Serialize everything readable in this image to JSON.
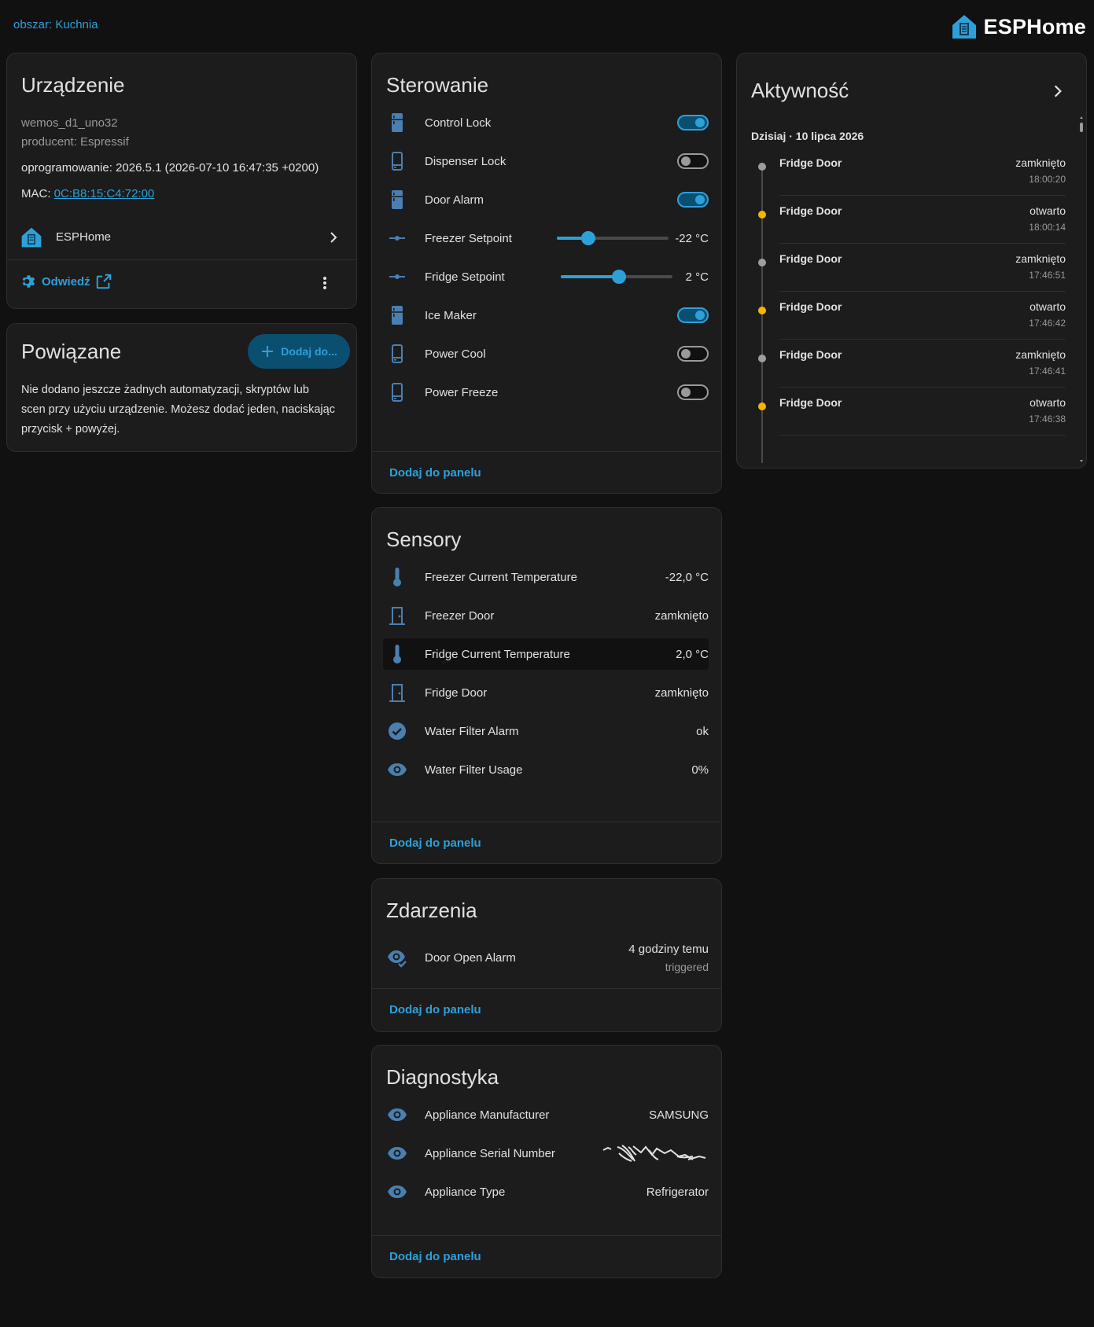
{
  "header": {
    "area_link": "obszar: Kuchnia",
    "brand": "ESPHome",
    "brand_color": "#2ea0d8"
  },
  "device": {
    "title": "Urządzenie",
    "model": "wemos_d1_uno32",
    "manufacturer": "producent: Espressif",
    "firmware": "oprogramowanie: 2026.5.1 (2026-07-10 16:47:35 +0200)",
    "mac_label": "MAC: ",
    "mac": "0C:B8:15:C4:72:00",
    "integration": "ESPHome",
    "visit": "Odwiedź"
  },
  "related": {
    "title": "Powiązane",
    "add_button": "Dodaj do...",
    "text": "Nie dodano jeszcze żadnych automatyzacji, skryptów lub scen przy użyciu urządzenie. Możesz dodać jeden, naciskając przycisk + powyżej."
  },
  "controls": {
    "title": "Sterowanie",
    "rows": [
      {
        "label": "Control Lock",
        "type": "toggle",
        "on": true,
        "icon": "fridge-icon"
      },
      {
        "label": "Dispenser Lock",
        "type": "toggle",
        "on": false,
        "icon": "fridge-outline-icon"
      },
      {
        "label": "Door Alarm",
        "type": "toggle",
        "on": true,
        "icon": "fridge-icon"
      },
      {
        "label": "Freezer Setpoint",
        "type": "slider",
        "value": "-22 °C",
        "level": 0.28,
        "icon": "ray-vertex-icon"
      },
      {
        "label": "Fridge Setpoint",
        "type": "slider",
        "value": "2 °C",
        "level": 0.52,
        "icon": "ray-vertex-icon"
      },
      {
        "label": "Ice Maker",
        "type": "toggle",
        "on": true,
        "icon": "fridge-icon"
      },
      {
        "label": "Power Cool",
        "type": "toggle",
        "on": false,
        "icon": "fridge-outline-icon"
      },
      {
        "label": "Power Freeze",
        "type": "toggle",
        "on": false,
        "icon": "fridge-outline-icon"
      }
    ],
    "add_to_panel": "Dodaj do panelu"
  },
  "sensors": {
    "title": "Sensory",
    "rows": [
      {
        "label": "Freezer Current Temperature",
        "value": "-22,0 °C",
        "icon": "thermometer-icon"
      },
      {
        "label": "Freezer Door",
        "value": "zamknięto",
        "icon": "door-closed-icon"
      },
      {
        "label": "Fridge Current Temperature",
        "value": "2,0 °C",
        "icon": "thermometer-icon"
      },
      {
        "label": "Fridge Door",
        "value": "zamknięto",
        "icon": "door-closed-icon"
      },
      {
        "label": "Water Filter Alarm",
        "value": "ok",
        "icon": "check-circle-icon"
      },
      {
        "label": "Water Filter Usage",
        "value": "0%",
        "icon": "eye-icon"
      }
    ],
    "add_to_panel": "Dodaj do panelu"
  },
  "events": {
    "title": "Zdarzenia",
    "rows": [
      {
        "label": "Door Open Alarm",
        "value": "4 godziny temu",
        "sub": "triggered",
        "icon": "eye-check-icon"
      }
    ],
    "add_to_panel": "Dodaj do panelu"
  },
  "diagnostics": {
    "title": "Diagnostyka",
    "rows": [
      {
        "label": "Appliance Manufacturer",
        "value": "SAMSUNG",
        "icon": "eye-icon"
      },
      {
        "label": "Appliance Serial Number",
        "value": "",
        "redacted": true,
        "icon": "eye-icon"
      },
      {
        "label": "Appliance Type",
        "value": "Refrigerator",
        "icon": "eye-icon"
      }
    ],
    "add_to_panel": "Dodaj do panelu"
  },
  "activity": {
    "title": "Aktywność",
    "date": "Dzisiaj · 10 lipca 2026",
    "items": [
      {
        "name": "Fridge Door",
        "state": "zamknięto",
        "time": "18:00:20",
        "dot": "#9e9e9e"
      },
      {
        "name": "Fridge Door",
        "state": "otwarto",
        "time": "18:00:14",
        "dot": "#f4b400"
      },
      {
        "name": "Fridge Door",
        "state": "zamknięto",
        "time": "17:46:51",
        "dot": "#9e9e9e"
      },
      {
        "name": "Fridge Door",
        "state": "otwarto",
        "time": "17:46:42",
        "dot": "#f4b400"
      },
      {
        "name": "Fridge Door",
        "state": "zamknięto",
        "time": "17:46:41",
        "dot": "#9e9e9e"
      },
      {
        "name": "Fridge Door",
        "state": "otwarto",
        "time": "17:46:38",
        "dot": "#f4b400"
      }
    ]
  }
}
